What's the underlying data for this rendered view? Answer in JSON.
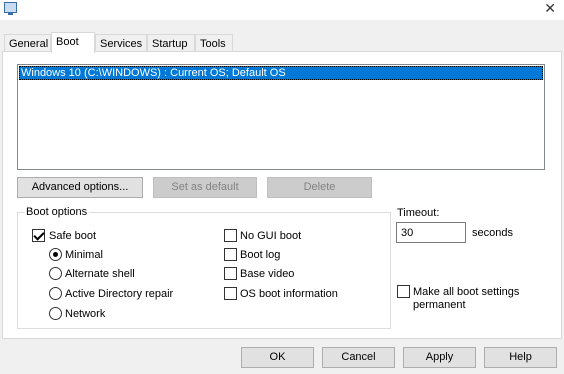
{
  "window": {
    "icon": "msconfig-app-icon",
    "close_glyph": "✕"
  },
  "tabs": [
    {
      "label": "General",
      "active": false
    },
    {
      "label": "Boot",
      "active": true
    },
    {
      "label": "Services",
      "active": false
    },
    {
      "label": "Startup",
      "active": false
    },
    {
      "label": "Tools",
      "active": false
    }
  ],
  "os_list": {
    "items": [
      "Windows 10 (C:\\WINDOWS) : Current OS; Default OS"
    ],
    "selected": 0
  },
  "buttons": {
    "advanced": "Advanced options...",
    "set_default": "Set as default",
    "delete": "Delete"
  },
  "boot_options": {
    "legend": "Boot options",
    "safe_boot": {
      "label": "Safe boot",
      "checked": true
    },
    "minimal": {
      "label": "Minimal",
      "checked": true
    },
    "alternate_shell": {
      "label": "Alternate shell",
      "checked": false
    },
    "ad_repair": {
      "label": "Active Directory repair",
      "checked": false
    },
    "network": {
      "label": "Network",
      "checked": false
    },
    "no_gui_boot": {
      "label": "No GUI boot",
      "checked": false
    },
    "boot_log": {
      "label": "Boot log",
      "checked": false
    },
    "base_video": {
      "label": "Base video",
      "checked": false
    },
    "os_boot_info": {
      "label": "OS boot information",
      "checked": false
    }
  },
  "timeout": {
    "label": "Timeout:",
    "value": "30",
    "unit": "seconds"
  },
  "permanent": {
    "label_line1": "Make all boot settings",
    "label_line2": "permanent",
    "checked": false
  },
  "footer": {
    "ok": "OK",
    "cancel": "Cancel",
    "apply": "Apply",
    "help": "Help"
  }
}
